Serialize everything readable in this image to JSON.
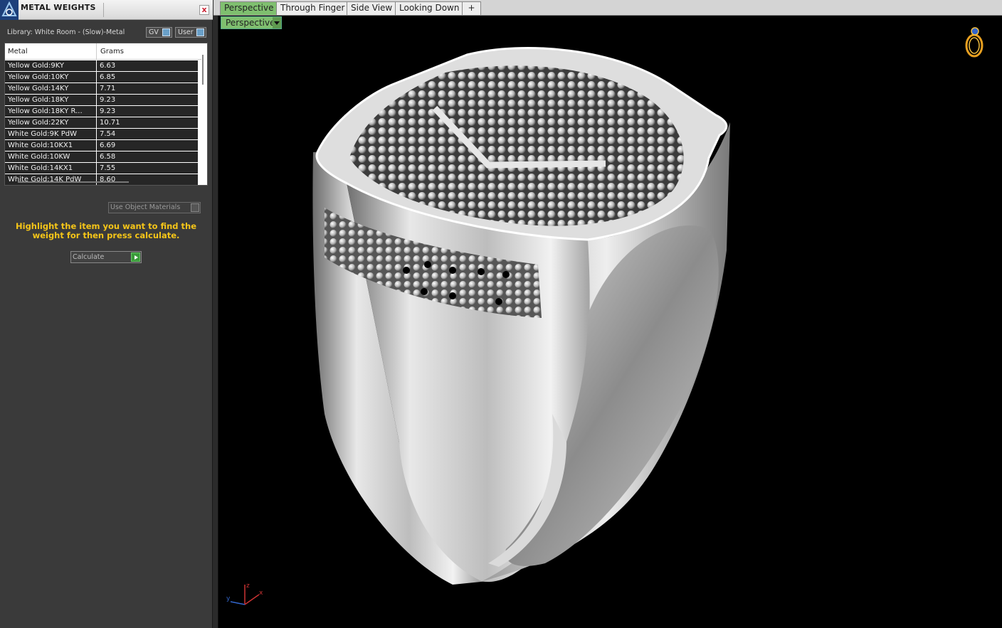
{
  "panel": {
    "title": "METAL WEIGHTS",
    "close_label": "x",
    "library_label": "Library: White Room - (Slow)-Metal",
    "toggles": [
      {
        "label": "GV"
      },
      {
        "label": "User"
      }
    ],
    "table": {
      "columns": [
        "Metal",
        "Grams"
      ],
      "rows": [
        {
          "metal": "Yellow Gold:9KY",
          "grams": "6.63"
        },
        {
          "metal": "Yellow Gold:10KY",
          "grams": "6.85"
        },
        {
          "metal": "Yellow Gold:14KY",
          "grams": "7.71"
        },
        {
          "metal": "Yellow Gold:18KY",
          "grams": "9.23"
        },
        {
          "metal": "Yellow Gold:18KY R...",
          "grams": "9.23"
        },
        {
          "metal": "Yellow Gold:22KY",
          "grams": "10.71"
        },
        {
          "metal": "White Gold:9K PdW",
          "grams": "7.54"
        },
        {
          "metal": "White Gold:10KX1",
          "grams": "6.69"
        },
        {
          "metal": "White Gold:10KW",
          "grams": "6.58"
        },
        {
          "metal": "White Gold:14KX1",
          "grams": "7.55"
        },
        {
          "metal": "White Gold:14K PdW",
          "grams": "8.60"
        }
      ]
    },
    "use_object_materials": "Use Object Materials",
    "hint": "Highlight the item you want to find the weight for then press calculate.",
    "calculate_label": "Calculate"
  },
  "viewport": {
    "tabs": [
      {
        "label": "Perspective",
        "active": true
      },
      {
        "label": "Through Finger"
      },
      {
        "label": "Side View"
      },
      {
        "label": "Looking Down"
      },
      {
        "label": "+"
      }
    ],
    "view_select": "Perspective",
    "axis": {
      "x": "x",
      "y": "y",
      "z": "z"
    }
  },
  "colors": {
    "accent_tab": "#7fbf6f",
    "hint_yellow": "#f5c518",
    "viewport_bg": "#000000"
  }
}
